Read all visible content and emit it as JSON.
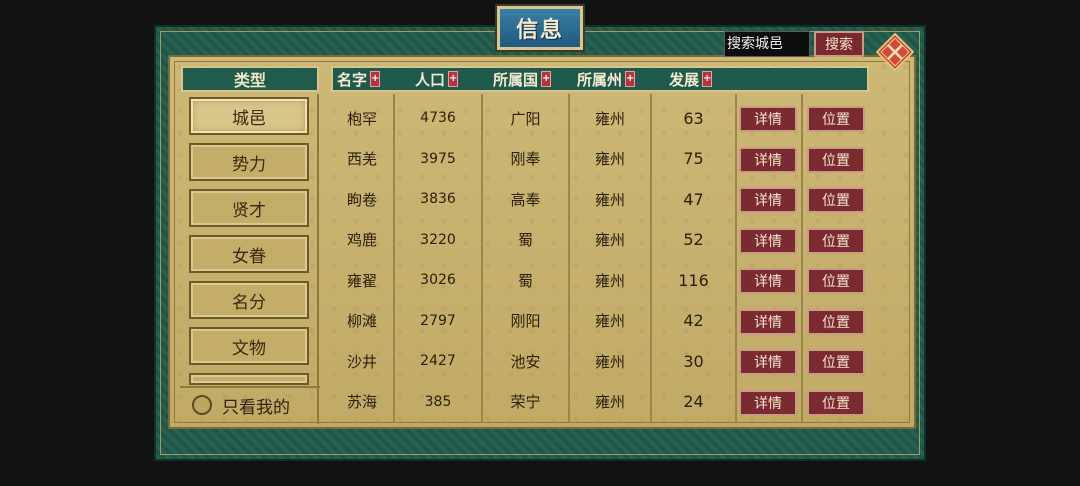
{
  "window": {
    "title": "信息"
  },
  "search": {
    "placeholder": "搜索城邑",
    "button_label": "搜索"
  },
  "sidebar": {
    "header": "类型",
    "items": [
      {
        "label": "城邑",
        "active": true
      },
      {
        "label": "势力",
        "active": false
      },
      {
        "label": "贤才",
        "active": false
      },
      {
        "label": "女眷",
        "active": false
      },
      {
        "label": "名分",
        "active": false
      },
      {
        "label": "文物",
        "active": false
      }
    ],
    "only_mine_label": "只看我的"
  },
  "table": {
    "columns": [
      "名字",
      "人口",
      "所属国",
      "所属州",
      "发展"
    ],
    "sort_icon": "+",
    "detail_label": "详情",
    "location_label": "位置",
    "rows": [
      {
        "name": "枹罕",
        "population": "4736",
        "country": "广阳",
        "state": "雍州",
        "development": "63"
      },
      {
        "name": "西羌",
        "population": "3975",
        "country": "刚奉",
        "state": "雍州",
        "development": "75"
      },
      {
        "name": "眗卷",
        "population": "3836",
        "country": "高奉",
        "state": "雍州",
        "development": "47"
      },
      {
        "name": "鸡鹿",
        "population": "3220",
        "country": "蜀",
        "state": "雍州",
        "development": "52"
      },
      {
        "name": "雍翟",
        "population": "3026",
        "country": "蜀",
        "state": "雍州",
        "development": "116"
      },
      {
        "name": "柳滩",
        "population": "2797",
        "country": "刚阳",
        "state": "雍州",
        "development": "42"
      },
      {
        "name": "沙井",
        "population": "2427",
        "country": "池安",
        "state": "雍州",
        "development": "30"
      },
      {
        "name": "苏海",
        "population": "385",
        "country": "荣宁",
        "state": "雍州",
        "development": "24"
      }
    ]
  },
  "colors": {
    "frame": "#1f5a4c",
    "parchment": "#c8b270",
    "button": "#7b2a31",
    "title_plate": "#2c6c94"
  },
  "icons": {
    "close": "close-x-icon",
    "sort": "sort-plus-icon",
    "radio": "radio-icon"
  }
}
